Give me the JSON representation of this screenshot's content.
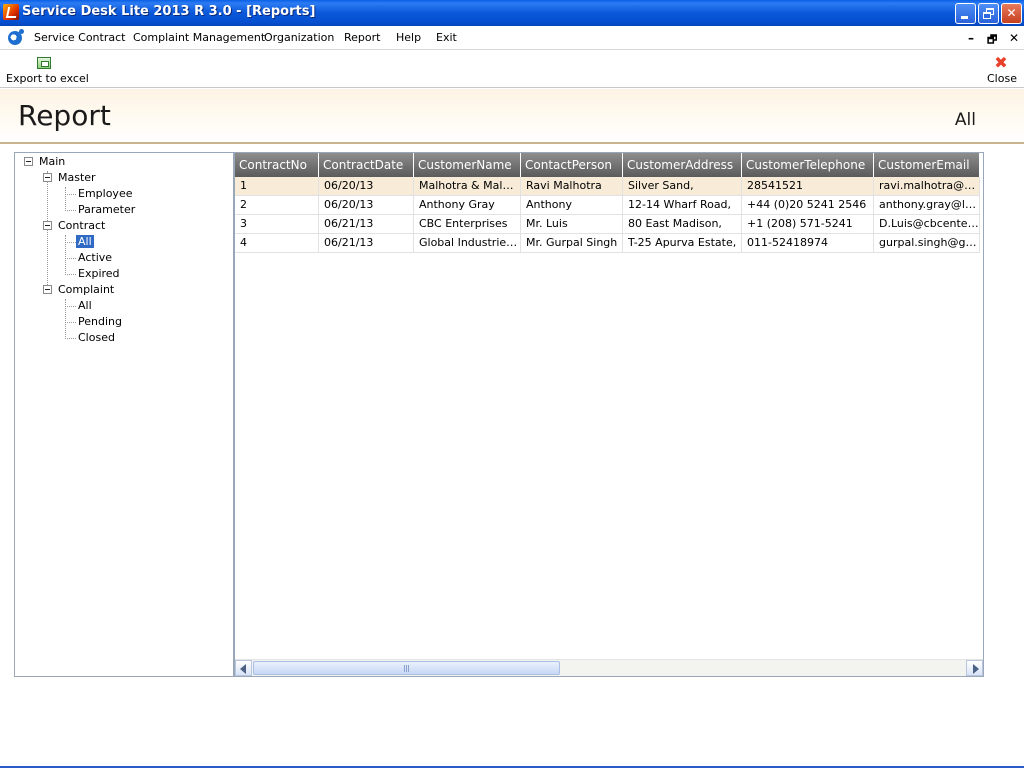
{
  "window": {
    "title": "Service Desk Lite 2013 R 3.0 - [Reports]",
    "minimize_glyph": "_",
    "restore_glyph": "❐",
    "close_glyph": "✕"
  },
  "menu": {
    "items": [
      {
        "label": "Service Contract"
      },
      {
        "label": "Complaint Management"
      },
      {
        "label": "Organization"
      },
      {
        "label": "Report"
      },
      {
        "label": "Help"
      },
      {
        "label": "Exit"
      }
    ],
    "mdi_minimize": "–",
    "mdi_restore": "🗗",
    "mdi_close": "✕"
  },
  "toolbar": {
    "export_label": "Export to excel",
    "close_label": "Close",
    "close_glyph": "✖"
  },
  "header": {
    "title": "Report",
    "filter": "All"
  },
  "tree": {
    "root": "Main",
    "master": "Master",
    "employee": "Employee",
    "parameter": "Parameter",
    "contract": "Contract",
    "contract_all": "All",
    "contract_active": "Active",
    "contract_expired": "Expired",
    "complaint": "Complaint",
    "complaint_all": "All",
    "complaint_pending": "Pending",
    "complaint_closed": "Closed"
  },
  "grid": {
    "columns": [
      "ContractNo",
      "ContractDate",
      "CustomerName",
      "ContactPerson",
      "CustomerAddress",
      "CustomerTelephone",
      "CustomerEmail"
    ],
    "rows": [
      [
        "1",
        "06/20/13",
        "Malhotra & Malho…",
        "Ravi Malhotra",
        "Silver Sand,",
        "28541521",
        "ravi.malhotra@g…"
      ],
      [
        "2",
        "06/20/13",
        "Anthony Gray",
        "Anthony",
        "12-14 Wharf Road,",
        "+44 (0)20 5241 2546",
        "anthony.gray@liv…"
      ],
      [
        "3",
        "06/21/13",
        "CBC Enterprises",
        "Mr. Luis",
        "80 East Madison,",
        "+1 (208) 571-5241",
        "D.Luis@cbcenter…"
      ],
      [
        "4",
        "06/21/13",
        "Global  Industries…",
        "Mr. Gurpal Singh",
        "T-25 Apurva Estate,",
        "011-52418974",
        "gurpal.singh@glo…"
      ]
    ]
  },
  "colors": {
    "titlebar": "#0a58da",
    "selection": "#316ac5",
    "header_band": "#fdf3e4",
    "grid_header": "#6e6e6e",
    "row_highlight": "#f8ecd8"
  }
}
